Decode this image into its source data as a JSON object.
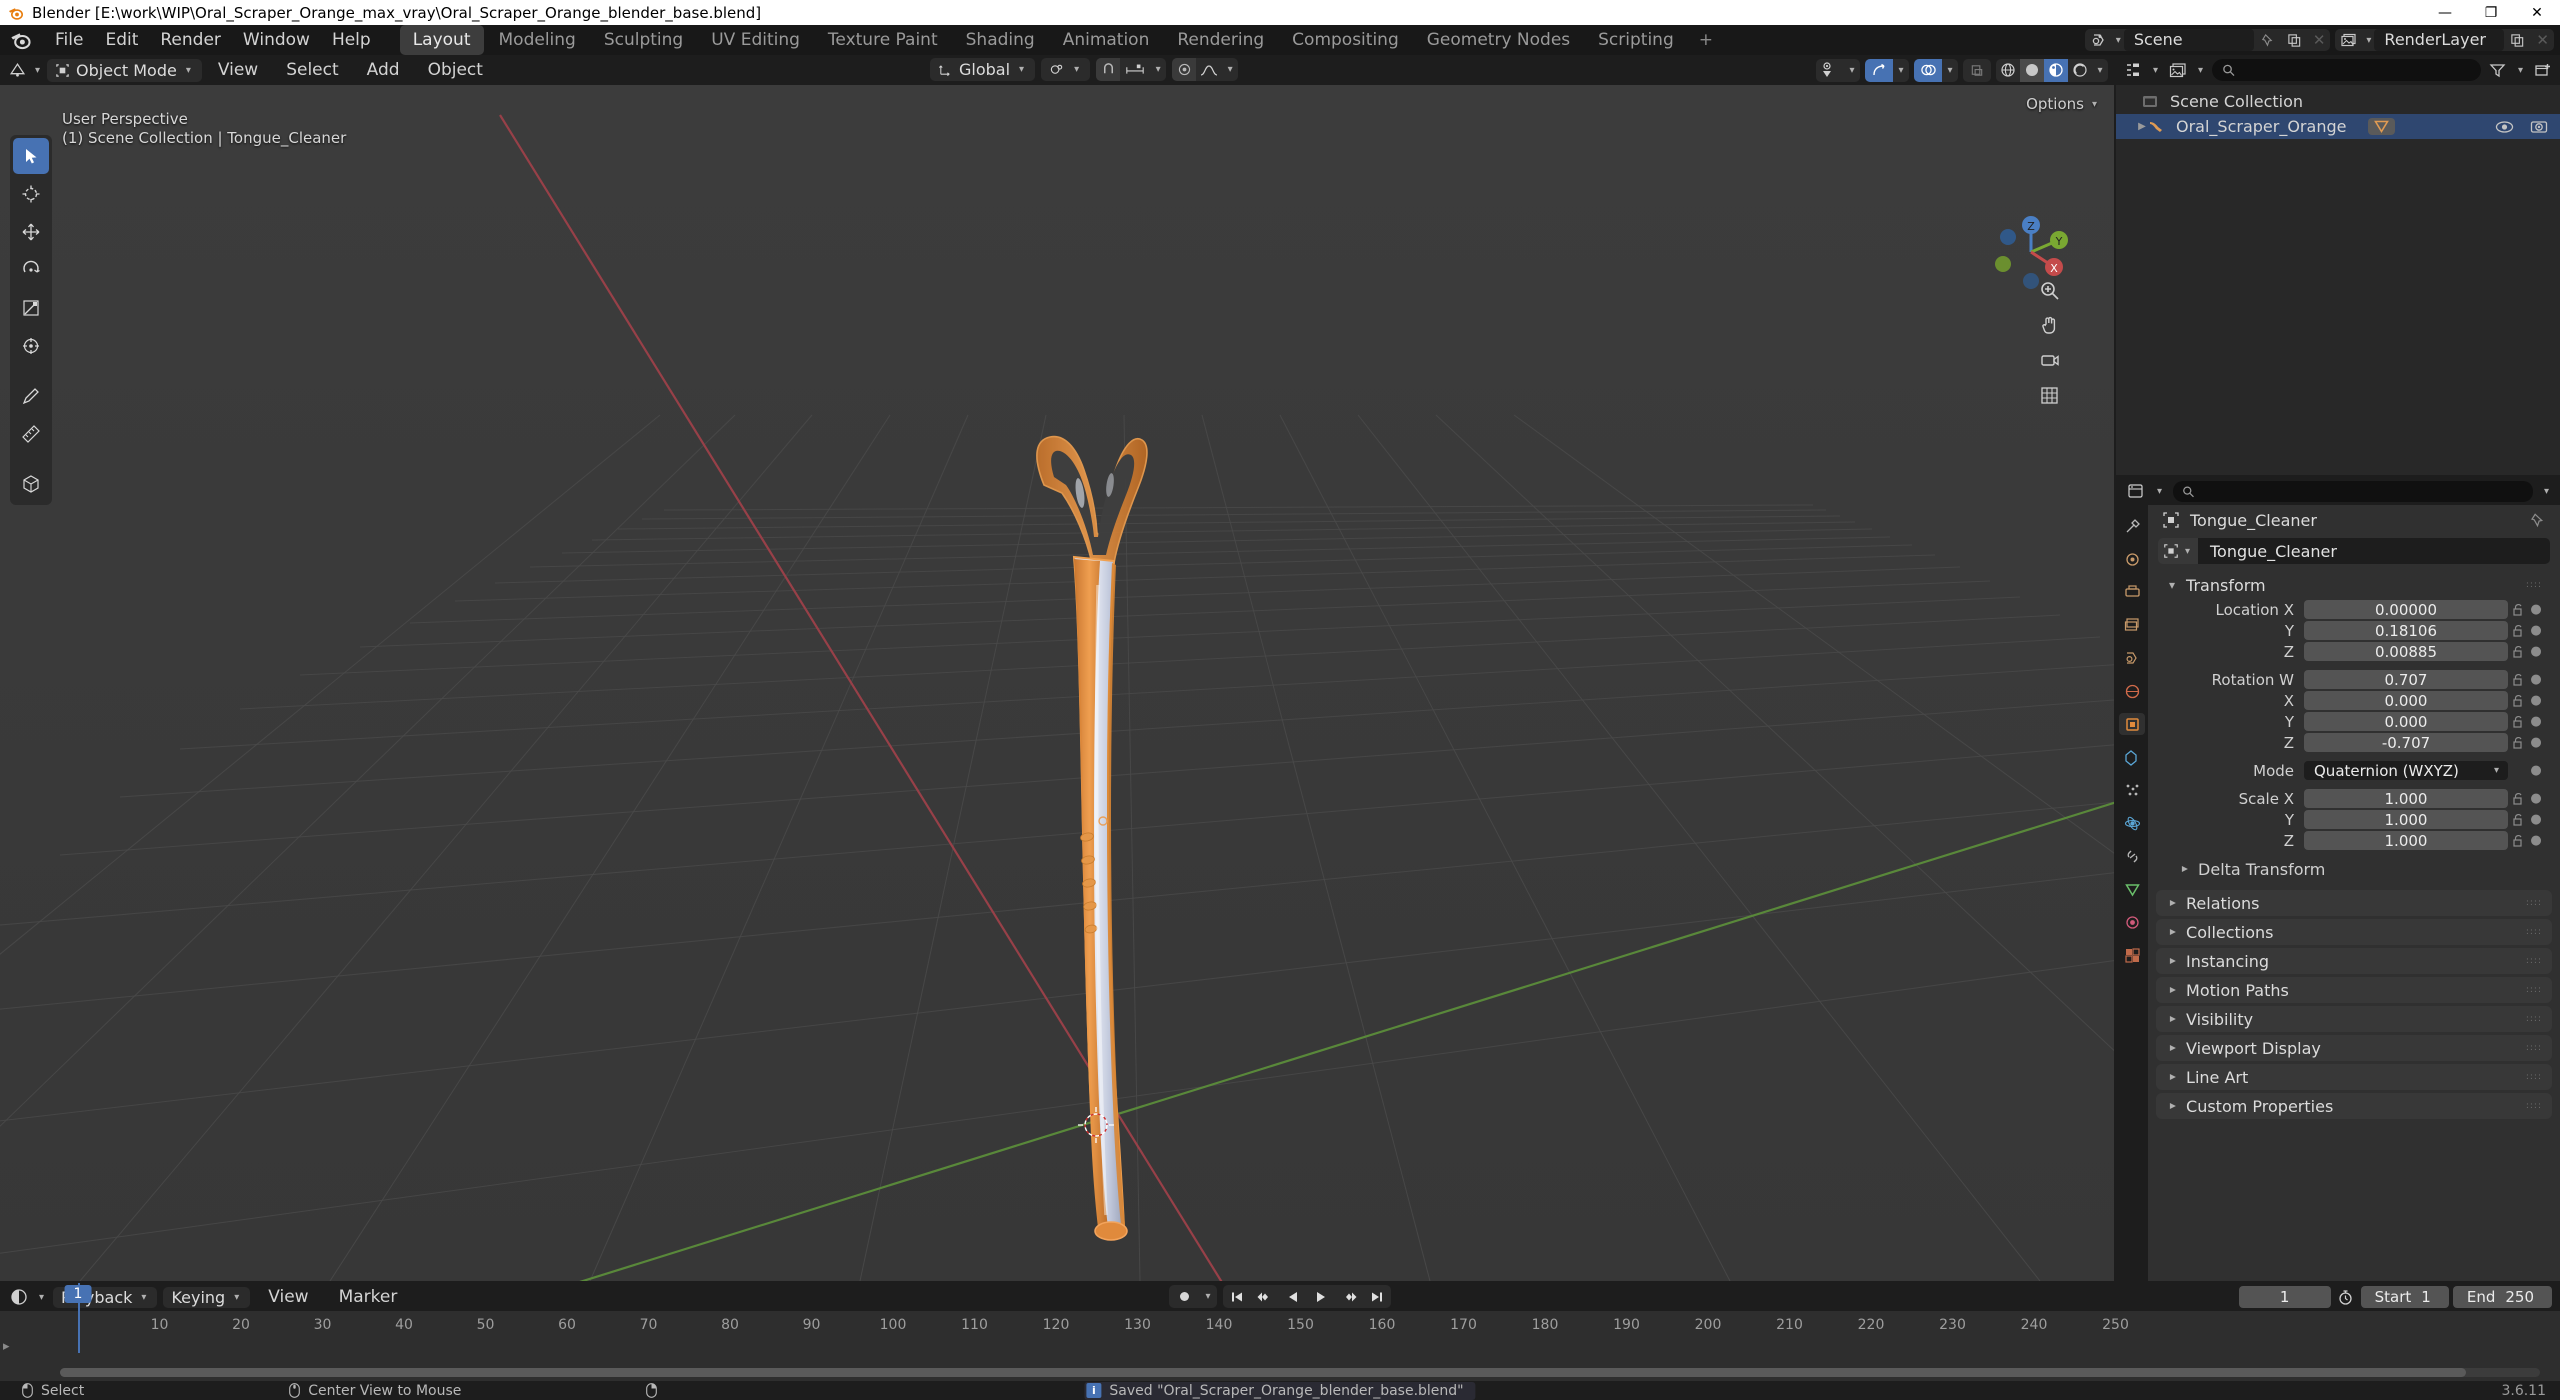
{
  "window": {
    "title": "Blender [E:\\work\\WIP\\Oral_Scraper_Orange_max_vray\\Oral_Scraper_Orange_blender_base.blend]",
    "minimize": "—",
    "maximize": "❐",
    "close": "✕"
  },
  "topbar": {
    "menus": [
      "File",
      "Edit",
      "Render",
      "Window",
      "Help"
    ],
    "workspaces": [
      {
        "label": "Layout",
        "active": true
      },
      {
        "label": "Modeling",
        "active": false
      },
      {
        "label": "Sculpting",
        "active": false
      },
      {
        "label": "UV Editing",
        "active": false
      },
      {
        "label": "Texture Paint",
        "active": false
      },
      {
        "label": "Shading",
        "active": false
      },
      {
        "label": "Animation",
        "active": false
      },
      {
        "label": "Rendering",
        "active": false
      },
      {
        "label": "Compositing",
        "active": false
      },
      {
        "label": "Geometry Nodes",
        "active": false
      },
      {
        "label": "Scripting",
        "active": false
      }
    ],
    "add_workspace": "+",
    "scene_name": "Scene",
    "viewlayer_name": "RenderLayer"
  },
  "viewport": {
    "mode": "Object Mode",
    "menus": [
      "View",
      "Select",
      "Add",
      "Object"
    ],
    "transform_orientation": "Global",
    "overlay_line1": "User Perspective",
    "overlay_line2": "(1) Scene Collection | Tongue_Cleaner",
    "options_label": "Options",
    "axis_labels": {
      "x": "X",
      "y": "Y",
      "z": "Z"
    },
    "tools": [
      "tweak-select-tool",
      "cursor-tool",
      "move-tool",
      "rotate-tool",
      "scale-tool",
      "transform-tool",
      "annotate-tool",
      "measure-tool",
      "add-cube-tool"
    ],
    "nav_buttons": [
      "zoom-icon",
      "pan-icon",
      "camera-icon",
      "grid-ortho-icon"
    ]
  },
  "outliner": {
    "search_placeholder": "",
    "scene_collection": "Scene Collection",
    "items": [
      {
        "label": "Oral_Scraper_Orange",
        "type": "mesh-object",
        "selected": true
      }
    ]
  },
  "properties": {
    "search_placeholder": "",
    "breadcrumb_object": "Tongue_Cleaner",
    "object_name": "Tongue_Cleaner",
    "transform": {
      "title": "Transform",
      "rows": [
        {
          "label": "Location X",
          "value": "0.00000"
        },
        {
          "label": "Y",
          "value": "0.18106"
        },
        {
          "label": "Z",
          "value": "0.00885"
        }
      ],
      "rotation": [
        {
          "label": "Rotation W",
          "value": "0.707"
        },
        {
          "label": "X",
          "value": "0.000"
        },
        {
          "label": "Y",
          "value": "0.000"
        },
        {
          "label": "Z",
          "value": "-0.707"
        }
      ],
      "mode_label": "Mode",
      "mode_value": "Quaternion (WXYZ)",
      "scale": [
        {
          "label": "Scale X",
          "value": "1.000"
        },
        {
          "label": "Y",
          "value": "1.000"
        },
        {
          "label": "Z",
          "value": "1.000"
        }
      ],
      "delta_transform": "Delta Transform"
    },
    "panels": [
      "Relations",
      "Collections",
      "Instancing",
      "Motion Paths",
      "Visibility",
      "Viewport Display",
      "Line Art",
      "Custom Properties"
    ]
  },
  "timeline": {
    "menus": [
      "Playback",
      "Keying",
      "View",
      "Marker"
    ],
    "current_frame": "1",
    "start_label": "Start",
    "start_value": "1",
    "end_label": "End",
    "end_value": "250",
    "ticks": [
      "10",
      "20",
      "30",
      "40",
      "50",
      "60",
      "70",
      "80",
      "90",
      "100",
      "110",
      "120",
      "130",
      "140",
      "150",
      "160",
      "170",
      "180",
      "190",
      "200",
      "210",
      "220",
      "230",
      "240",
      "250"
    ],
    "playhead_frame": "1"
  },
  "statusbar": {
    "left_items": [
      {
        "icon": "mouse-left-icon",
        "label": "Select"
      },
      {
        "icon": "mouse-middle-icon",
        "label": "Center View to Mouse"
      },
      {
        "icon": "mouse-right-icon",
        "label": ""
      }
    ],
    "report": "Saved \"Oral_Scraper_Orange_blender_base.blend\"",
    "version": "3.6.11"
  },
  "colors": {
    "accent_blue": "#4772b3",
    "object_orange": "#e08a3c",
    "panel_bg": "#303030",
    "header_bg": "#1d1d1d",
    "viewport_bg": "#393939"
  }
}
